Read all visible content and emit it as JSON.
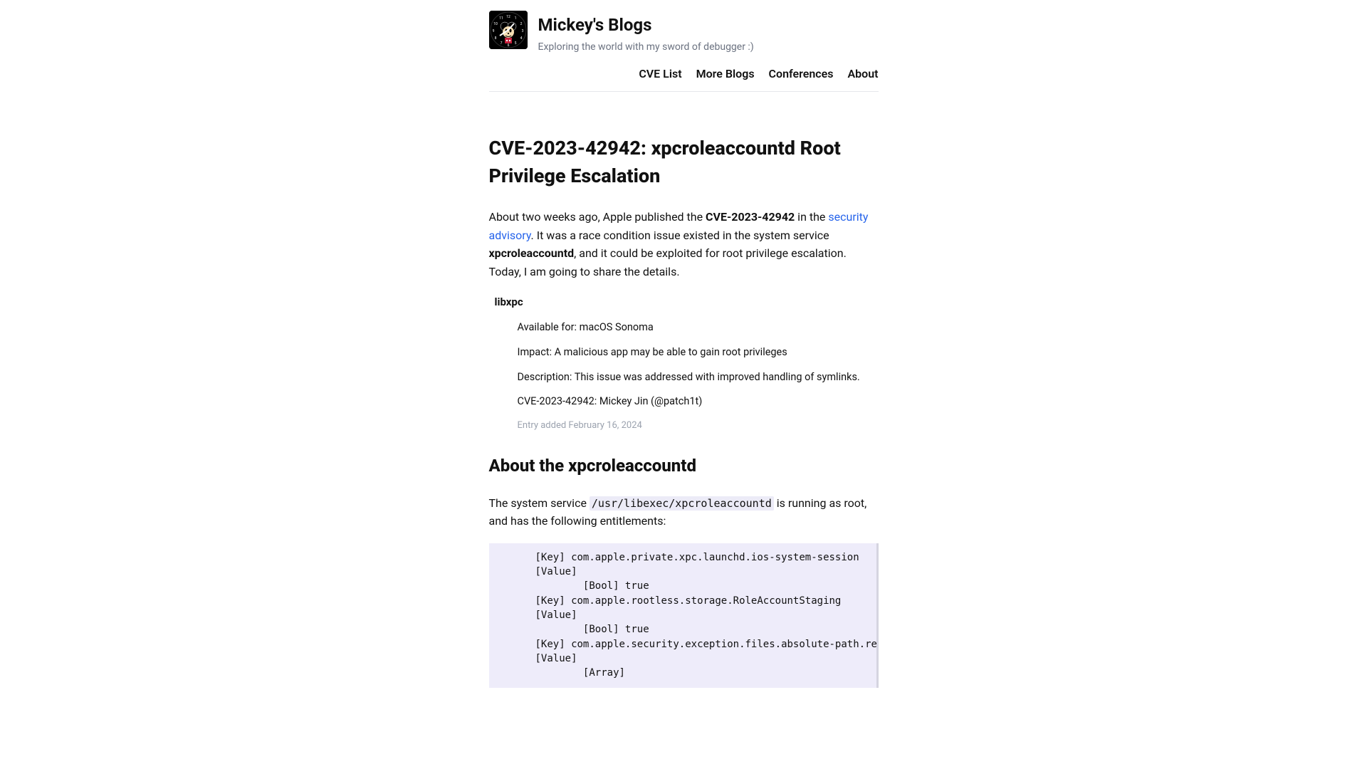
{
  "header": {
    "site_title": "Mickey's Blogs",
    "tagline": "Exploring the world with my sword of debugger :)"
  },
  "nav": {
    "cve_list": "CVE List",
    "more_blogs": "More Blogs",
    "conferences": "Conferences",
    "about": "About"
  },
  "article": {
    "title": "CVE-2023-42942: xpcroleaccountd Root Privilege Escalation",
    "intro": {
      "pre": "About two weeks ago, Apple published the ",
      "cve_bold": "CVE-2023-42942",
      "mid": " in the ",
      "link_text": "security advisory",
      "after_link": ". It was a race condition issue existed in the system service ",
      "service_bold": "xpcroleaccountd",
      "tail": ", and it could be exploited for root privilege escalation. Today, I am going to share the details."
    },
    "advisory": {
      "heading": "libxpc",
      "available_for": "Available for: macOS Sonoma",
      "impact": "Impact: A malicious app may be able to gain root privileges",
      "description": "Description: This issue was addressed with improved handling of symlinks.",
      "credit": "CVE-2023-42942: Mickey Jin (@patch1t)",
      "entry_added": "Entry added February 16, 2024"
    },
    "section_heading": "About the xpcroleaccountd",
    "system_service_text": {
      "pre": "The system service ",
      "code": "/usr/libexec/xpcroleaccountd",
      "post": " is running as root, and has the following entitlements:"
    },
    "code_block": "[Key] com.apple.private.xpc.launchd.ios-system-session\n[Value]\n        [Bool] true\n[Key] com.apple.rootless.storage.RoleAccountStaging\n[Value]\n        [Bool] true\n[Key] com.apple.security.exception.files.absolute-path.rea\n[Value]\n        [Array]"
  }
}
